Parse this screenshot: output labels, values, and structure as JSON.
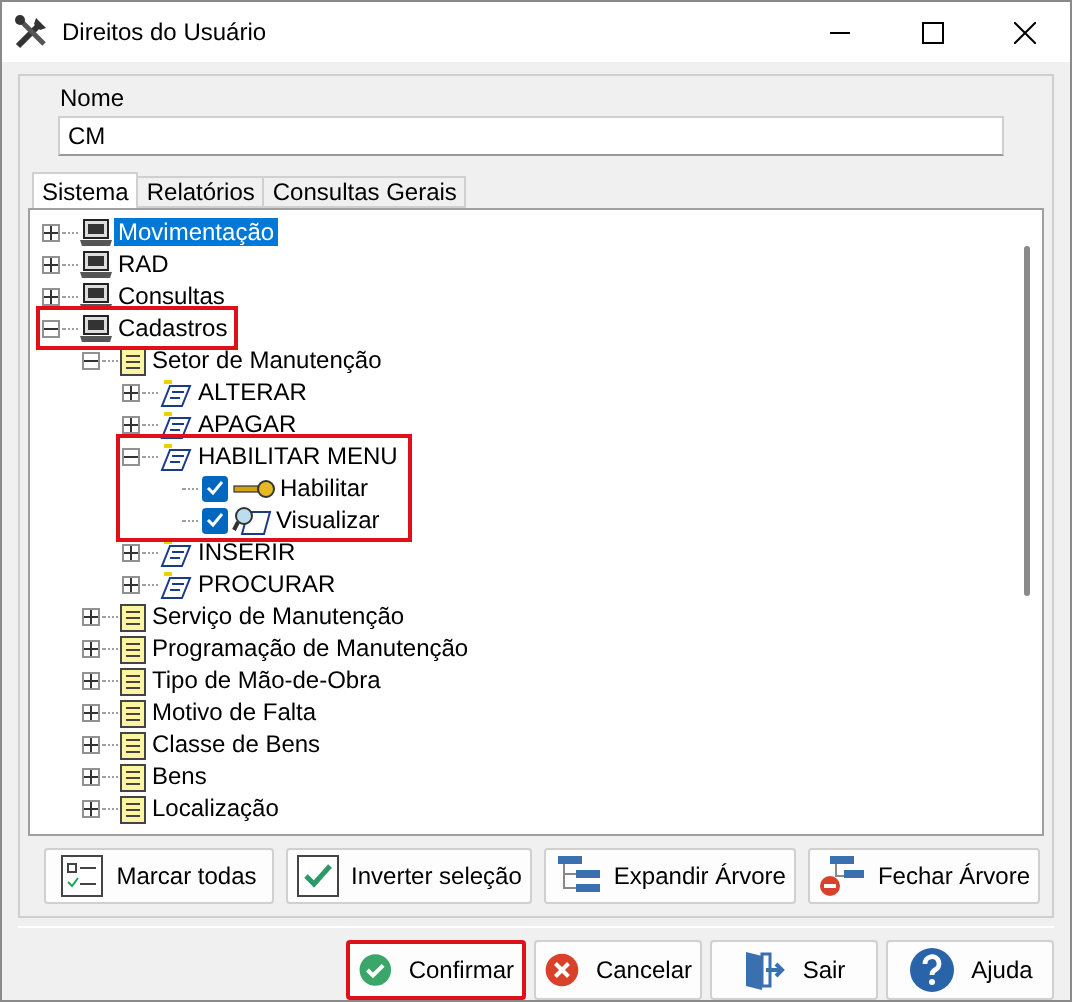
{
  "window": {
    "title": "Direitos do Usuário"
  },
  "name_field": {
    "label": "Nome",
    "value": "CM"
  },
  "tabs": [
    {
      "label": "Sistema",
      "selected": true
    },
    {
      "label": "Relatórios",
      "selected": false
    },
    {
      "label": "Consultas Gerais",
      "selected": false
    }
  ],
  "tree": [
    {
      "label": "Movimentação",
      "kind": "computer",
      "expanded": false,
      "selected": true
    },
    {
      "label": "RAD",
      "kind": "computer",
      "expanded": false,
      "selected": false
    },
    {
      "label": "Consultas",
      "kind": "computer",
      "expanded": false,
      "selected": false
    },
    {
      "label": "Cadastros",
      "kind": "computer",
      "expanded": true,
      "selected": false,
      "row_highlighted": true,
      "children": [
        {
          "label": "Setor de Manutenção",
          "kind": "form",
          "expanded": true,
          "selected": false,
          "children": [
            {
              "label": "ALTERAR",
              "kind": "script",
              "expanded": false,
              "selected": false
            },
            {
              "label": "APAGAR",
              "kind": "script",
              "expanded": false,
              "selected": false
            },
            {
              "label": "HABILITAR MENU",
              "kind": "script",
              "expanded": true,
              "selected": false,
              "branch_highlighted": true,
              "children": [
                {
                  "label": "Habilitar",
                  "kind": "key",
                  "checked": true,
                  "selected": false
                },
                {
                  "label": "Visualizar",
                  "kind": "view",
                  "checked": true,
                  "selected": false
                }
              ]
            },
            {
              "label": "INSERIR",
              "kind": "script",
              "expanded": false,
              "selected": false
            },
            {
              "label": "PROCURAR",
              "kind": "script",
              "expanded": false,
              "selected": false
            }
          ]
        },
        {
          "label": "Serviço de Manutenção",
          "kind": "form",
          "expanded": false,
          "selected": false
        },
        {
          "label": "Programação de Manutenção",
          "kind": "form",
          "expanded": false,
          "selected": false
        },
        {
          "label": "Tipo de Mão-de-Obra",
          "kind": "form",
          "expanded": false,
          "selected": false
        },
        {
          "label": "Motivo de Falta",
          "kind": "form",
          "expanded": false,
          "selected": false
        },
        {
          "label": "Classe de Bens",
          "kind": "form",
          "expanded": false,
          "selected": false
        },
        {
          "label": "Bens",
          "kind": "form",
          "expanded": false,
          "selected": false
        },
        {
          "label": "Localização",
          "kind": "form",
          "expanded": false,
          "selected": false
        }
      ]
    }
  ],
  "tree_buttons": [
    {
      "label": "Marcar todas",
      "kind": "check-list"
    },
    {
      "label": "Inverter seleção",
      "kind": "check"
    },
    {
      "label": "Expandir Árvore",
      "kind": "expand"
    },
    {
      "label": "Fechar Árvore",
      "kind": "collapse"
    }
  ],
  "footer_buttons": [
    {
      "label": "Confirmar",
      "kind": "ok",
      "highlighted": true
    },
    {
      "label": "Cancelar",
      "kind": "cancel",
      "highlighted": false
    },
    {
      "label": "Sair",
      "kind": "exit",
      "highlighted": false
    },
    {
      "label": "Ajuda",
      "kind": "help",
      "highlighted": false
    }
  ]
}
